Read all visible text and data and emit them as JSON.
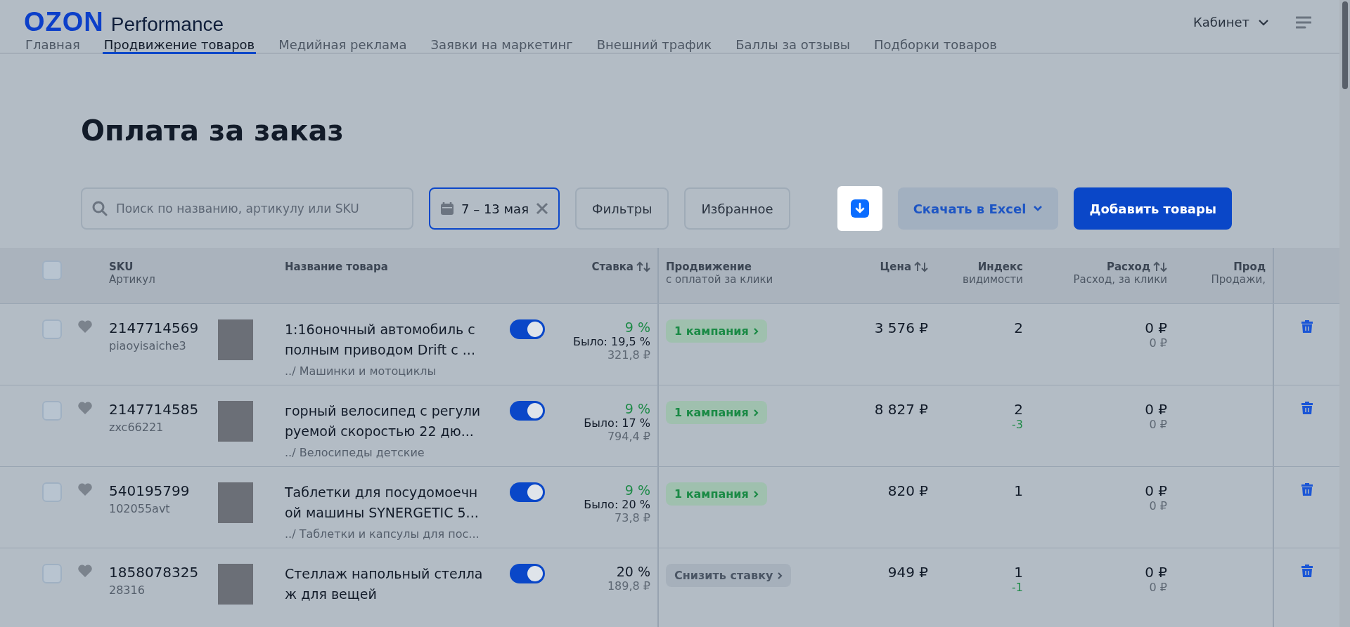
{
  "header": {
    "logo": "OZON",
    "logo_suffix": "Performance",
    "account": "Кабинет"
  },
  "tabs": [
    {
      "label": "Главная",
      "selected": false
    },
    {
      "label": "Продвижение товаров",
      "selected": true
    },
    {
      "label": "Медийная реклама",
      "selected": false
    },
    {
      "label": "Заявки на маркетинг",
      "selected": false
    },
    {
      "label": "Внешний трафик",
      "selected": false
    },
    {
      "label": "Баллы за отзывы",
      "selected": false
    },
    {
      "label": "Подборки товаров",
      "selected": false
    }
  ],
  "page_title": "Оплата за заказ",
  "toolbar": {
    "search": {
      "placeholder": "Поиск по названию, артикулу или SKU"
    },
    "date_range": "7 – 13 мая",
    "filters": "Фильтры",
    "favorites": "Избранное",
    "excel": "Скачать в Excel",
    "add": "Добавить товары"
  },
  "table": {
    "select_all": {
      "checked": false
    },
    "columns": [
      {
        "title": "SKU",
        "subtitle": "Артикул",
        "sortable": false
      },
      {
        "title": "Название товара",
        "sortable": false
      },
      {
        "title": "Ставка",
        "sortable": true
      },
      {
        "title": "Продвижение",
        "subtitle": "с оплатой за клики",
        "sortable": false
      },
      {
        "title": "Цена",
        "sortable": true
      },
      {
        "title": "Индекс",
        "subtitle": "видимости",
        "sortable": false
      },
      {
        "title": "Расход",
        "subtitle": "Расход, за клики",
        "sortable": true
      },
      {
        "title": "Прод",
        "subtitle": "Продажи,",
        "sortable": false
      }
    ],
    "rows": [
      {
        "checked": false,
        "favorite": false,
        "sku": "2147714569",
        "article": "piaoyisaiche3",
        "name": "1:16оночный автомобиль с полным приводом Drift с ...",
        "category": "../ Машинки и мотоциклы",
        "on": true,
        "rate": "9 %",
        "was": "Было: 19,5 %",
        "rate_sum": "321,8 ₽",
        "promo": {
          "kind": "campaign",
          "label": "1 кампания"
        },
        "price": "3 576 ₽",
        "index": "2",
        "expense": "0 ₽",
        "expense_clicks": "0 ₽"
      },
      {
        "checked": false,
        "favorite": false,
        "sku": "2147714585",
        "article": "zxc66221",
        "name": "горный велосипед с регули руемой скоростью 22 дю...",
        "category": "../ Велосипеды детские",
        "on": true,
        "rate": "9 %",
        "was": "Было: 17 %",
        "rate_sum": "794,4 ₽",
        "promo": {
          "kind": "campaign",
          "label": "1 кампания"
        },
        "price": "8 827 ₽",
        "index": "2",
        "index_delta": "-3",
        "expense": "0 ₽",
        "expense_clicks": "0 ₽"
      },
      {
        "checked": false,
        "favorite": false,
        "sku": "540195799",
        "article": "102055avt",
        "name": "Таблетки для посудомоечн ой машины SYNERGETIC 5...",
        "category": "../ Таблетки и капсулы для пос...",
        "on": true,
        "rate": "9 %",
        "was": "Было: 20 %",
        "rate_sum": "73,8 ₽",
        "promo": {
          "kind": "campaign",
          "label": "1 кампания"
        },
        "price": "820 ₽",
        "index": "1",
        "expense": "0 ₽",
        "expense_clicks": "0 ₽"
      },
      {
        "checked": false,
        "favorite": false,
        "sku": "1858078325",
        "article": "28316",
        "name": "Стеллаж напольный стелла ж для вещей",
        "on": true,
        "rate": "20 %",
        "rate_sum": "189,8 ₽",
        "promo": {
          "kind": "lower",
          "label": "Снизить ставку"
        },
        "price": "949 ₽",
        "index": "1",
        "index_delta": "-1",
        "expense": "0 ₽",
        "expense_clicks": "0 ₽"
      }
    ]
  }
}
